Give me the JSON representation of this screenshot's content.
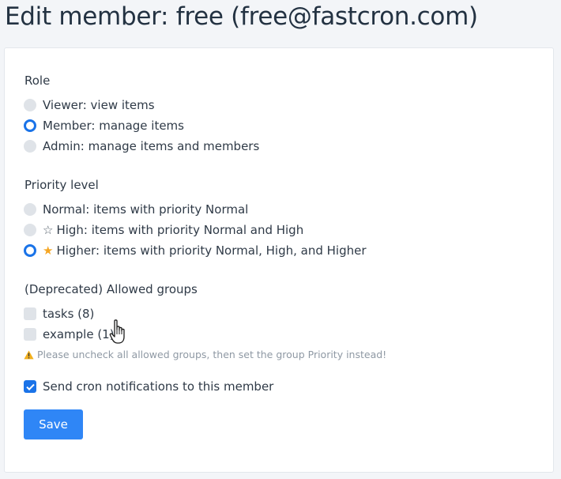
{
  "title": "Edit member: free (free@fastcron.com)",
  "role": {
    "label": "Role",
    "options": [
      {
        "label": "Viewer: view items",
        "selected": false
      },
      {
        "label": "Member: manage items",
        "selected": true
      },
      {
        "label": "Admin: manage items and members",
        "selected": false
      }
    ]
  },
  "priority": {
    "label": "Priority level",
    "options": [
      {
        "label": "Normal: items with priority Normal",
        "selected": false,
        "icon": ""
      },
      {
        "label": "High: items with priority Normal and High",
        "selected": false,
        "icon": "star-outline-icon",
        "glyph": "☆"
      },
      {
        "label": "Higher: items with priority Normal, High, and Higher",
        "selected": true,
        "icon": "star-filled-icon",
        "glyph": "★"
      }
    ]
  },
  "groups": {
    "label": "(Deprecated) Allowed groups",
    "items": [
      {
        "label": "tasks (8)",
        "checked": false
      },
      {
        "label": "example (1)",
        "checked": false
      }
    ],
    "warning": "Please uncheck all allowed groups, then set the group Priority instead!"
  },
  "notifications": {
    "label": "Send cron notifications to this member",
    "checked": true
  },
  "save_label": "Save",
  "colors": {
    "accent": "#1a73e8",
    "button": "#2f86f6",
    "warning_icon": "#f2b01e"
  }
}
